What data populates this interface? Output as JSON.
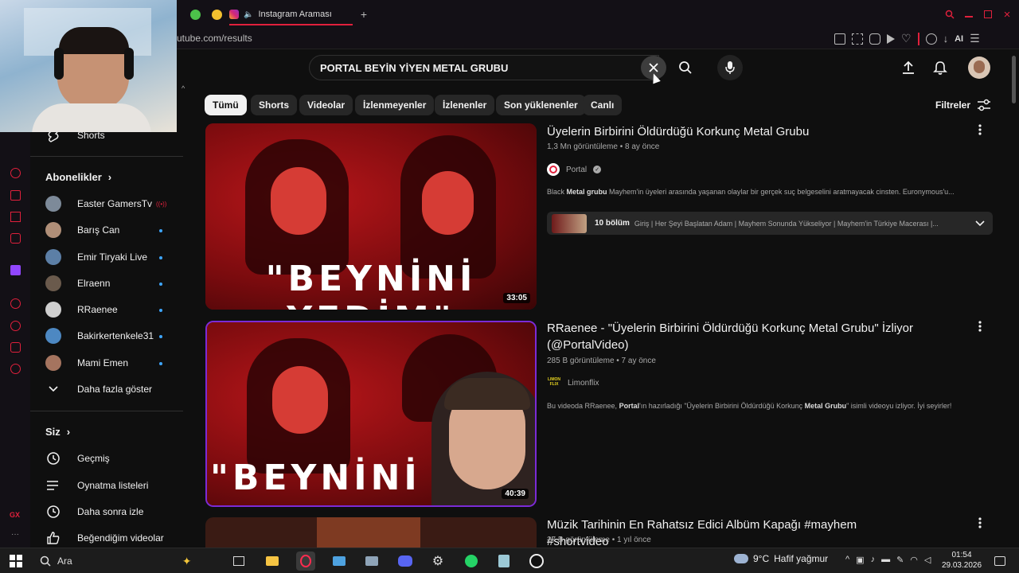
{
  "browser": {
    "tab_title": "Instagram Araması",
    "address": "utube.com/results",
    "ai_label": "AI"
  },
  "search": {
    "query": "PORTAL BEYİN YİYEN METAL GRUBU"
  },
  "chips": [
    "Tümü",
    "Shorts",
    "Videolar",
    "İzlenmeyenler",
    "İzlenenler",
    "Son yüklenenler",
    "Canlı"
  ],
  "filters_label": "Filtreler",
  "sidebar": {
    "shorts_label": "Shorts",
    "subscriptions_title": "Abonelikler",
    "subscriptions": [
      {
        "name": "Easter GamersTv"
      },
      {
        "name": "Barış Can"
      },
      {
        "name": "Emir Tiryaki Live"
      },
      {
        "name": "Elraenn"
      },
      {
        "name": "RRaenee"
      },
      {
        "name": "Bakirkertenkele31"
      },
      {
        "name": "Mami Emen"
      }
    ],
    "show_more": "Daha fazla göster",
    "you_title": "Siz",
    "you_items": [
      "Geçmiş",
      "Oynatma listeleri",
      "Daha sonra izle",
      "Beğendiğim videolar"
    ]
  },
  "results": [
    {
      "thumb_text": "\"BEYNİNİ YEDİM\"",
      "duration": "33:05",
      "title": "Üyelerin Birbirini Öldürdüğü Korkunç Metal Grubu",
      "meta": "1,3 Mn görüntüleme • 8 ay önce",
      "channel": "Portal",
      "desc_bold1": "Metal grubu",
      "desc_pre": "Black ",
      "desc_post": " Mayhem'in üyeleri arasında yaşanan olaylar bir gerçek suç belgeselini aratmayacak cinsten. Euronymous'u...",
      "chapters_label": "10 bölüm",
      "chapters_text": "Giriş | Her Şeyi Başlatan Adam | Mayhem Sonunda Yükseliyor | Mayhem'in Türkiye Macerası |..."
    },
    {
      "thumb_text": "\"BEYNİNİ",
      "duration": "40:39",
      "title": "RRaenee - \"Üyelerin Birbirini Öldürdüğü Korkunç Metal Grubu\" İzliyor (@PortalVideo)",
      "meta": "285 B görüntüleme • 7 ay önce",
      "channel": "Limonflix",
      "channel_logo_text": "LIMON FLIX",
      "desc_pre": "Bu videoda RRaenee, ",
      "desc_bold1": "Portal",
      "desc_mid": "'ın hazırladığı \"Üyelerin Birbirini Öldürdüğü Korkunç ",
      "desc_bold2": "Metal Grubu",
      "desc_post": "\" isimli videoyu izliyor. İyi seyirler!"
    },
    {
      "title": "Müzik Tarihinin En Rahatsız Edici Albüm Kapağı #mayhem #shortvideo",
      "meta": "27 B görüntüleme • 1 yıl önce"
    }
  ],
  "taskbar": {
    "search_label": "Ara",
    "weather_temp": "9°C",
    "weather_text": "Hafif yağmur",
    "time": "01:54",
    "date": "29.03.2026",
    "gx_label": "GX"
  },
  "colors": {
    "accent_red": "#e0203c",
    "live_dot": "#3ea6ff",
    "background": "#0f0f0f"
  }
}
